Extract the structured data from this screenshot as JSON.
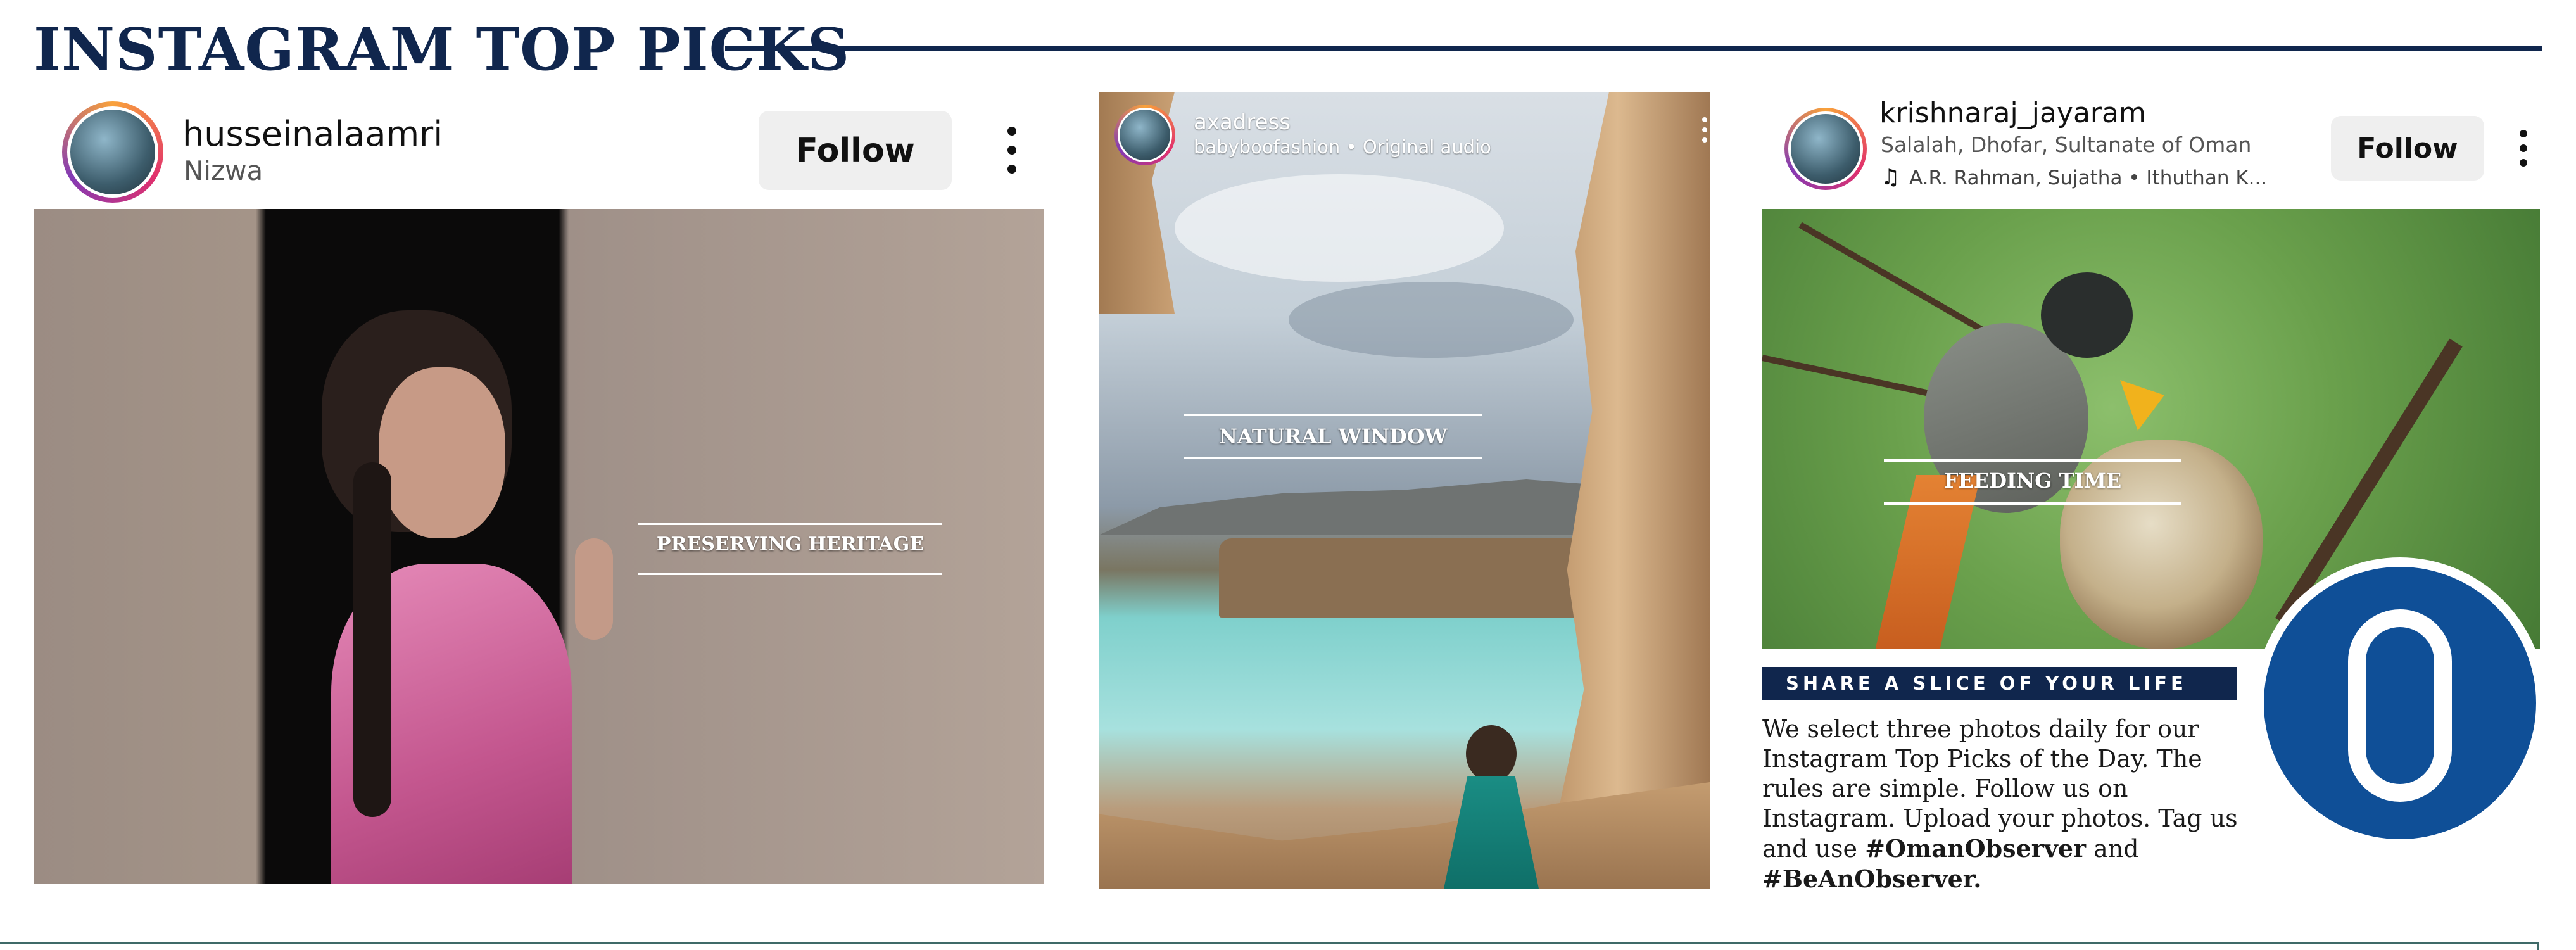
{
  "header": {
    "title": "INSTAGRAM TOP PICKS"
  },
  "cards": [
    {
      "username": "husseinalaamri",
      "location": "Nizwa",
      "follow_label": "Follow",
      "caption": "PRESERVING HERITAGE"
    },
    {
      "username": "axadress",
      "audio": "babyboofashion • Original audio",
      "caption": "NATURAL WINDOW"
    },
    {
      "username": "krishnaraj_jayaram",
      "location": "Salalah, Dhofar, Sultanate of Oman",
      "audio": "A.R. Rahman, Sujatha • Ithuthan K...",
      "follow_label": "Follow",
      "caption": "FEEDING TIME"
    }
  ],
  "info": {
    "banner": "SHARE A SLICE OF YOUR LIFE",
    "text_plain": "We select three photos daily for our Instagram Top Picks of the Day. The rules are simple. Follow us on Instagram. Upload your photos. Tag us and use",
    "hashtag1": "#OmanObserver",
    "and_word": "and",
    "hashtag2": "#BeAnObserver."
  },
  "logo": {
    "letter": "O",
    "color": "#0f4f97"
  },
  "colors": {
    "navy": "#10264d",
    "white": "#ffffff"
  }
}
